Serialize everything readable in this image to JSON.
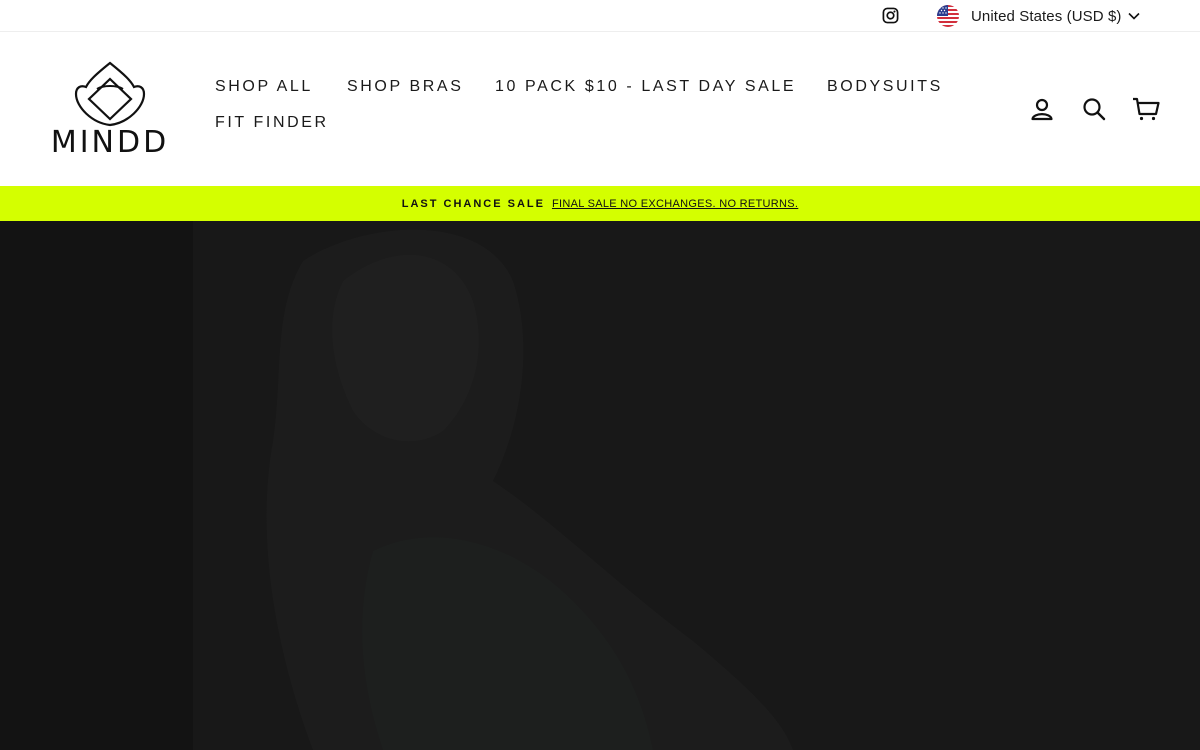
{
  "utility": {
    "instagram_icon": "instagram-icon",
    "currency_label": "United States (USD $)",
    "flag_icon": "us-flag-icon",
    "caret_icon": "chevron-down-icon"
  },
  "brand": {
    "name": "MINDD",
    "logo_icon": "lotus-logo-icon"
  },
  "nav": {
    "items": [
      {
        "label": "SHOP ALL"
      },
      {
        "label": "SHOP BRAS"
      },
      {
        "label": "10 PACK $10 - LAST DAY SALE"
      },
      {
        "label": "BODYSUITS"
      },
      {
        "label": "FIT FINDER"
      }
    ]
  },
  "header_icons": {
    "account": "user-icon",
    "search": "search-icon",
    "cart": "cart-icon"
  },
  "announcement": {
    "title": "LAST CHANCE SALE",
    "link_text": "FINAL SALE NO EXCHANGES. NO RETURNS.",
    "background": "#d4ff00"
  },
  "colors": {
    "accent": "#d4ff00",
    "hero_background": "#151515",
    "text": "#1a1a1a"
  }
}
